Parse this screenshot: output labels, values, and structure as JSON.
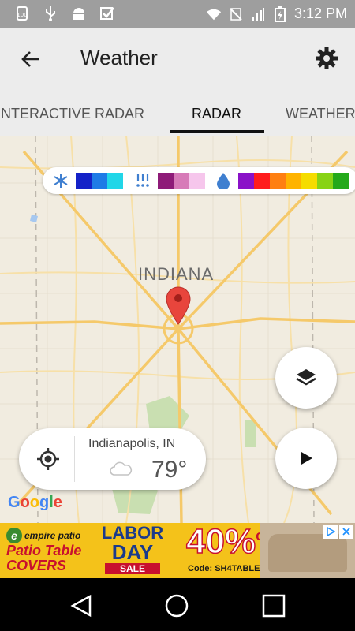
{
  "status_bar": {
    "left_icons": [
      "battery-saver-icon",
      "usb-icon",
      "android-icon",
      "task-check-icon"
    ],
    "right_icons": [
      "wifi-icon",
      "no-sim-icon",
      "signal-icon",
      "battery-charging-icon"
    ],
    "time": "3:12 PM"
  },
  "app_bar": {
    "title": "Weather"
  },
  "tabs": [
    {
      "label": "INTERACTIVE RADAR",
      "active": false
    },
    {
      "label": "RADAR",
      "active": true
    },
    {
      "label": "WEATHER",
      "active": false
    }
  ],
  "map": {
    "state_label": "INDIANA",
    "attribution": "Google",
    "legend": {
      "snow_colors": [
        "#1422c8",
        "#1e7be6",
        "#21d6e8"
      ],
      "mix_colors": [
        "#8e1b78",
        "#d77ab8",
        "#f6c6ec"
      ],
      "rain_colors": [
        "#8a12c8",
        "#ff1d1d",
        "#ff7f11",
        "#ffb300",
        "#f5dc00",
        "#88d315",
        "#24a91b"
      ]
    }
  },
  "location_card": {
    "city": "Indianapolis, IN",
    "temperature": "79°",
    "condition_icon": "cloud-icon"
  },
  "ad": {
    "brand": "empire patio",
    "headline": "Patio Table COVERS",
    "sale_line1": "LABOR",
    "sale_line2": "DAY",
    "sale_line3": "SALE",
    "discount": "40%",
    "discount_suffix": "off",
    "code": "Code: SH4TABLE"
  }
}
